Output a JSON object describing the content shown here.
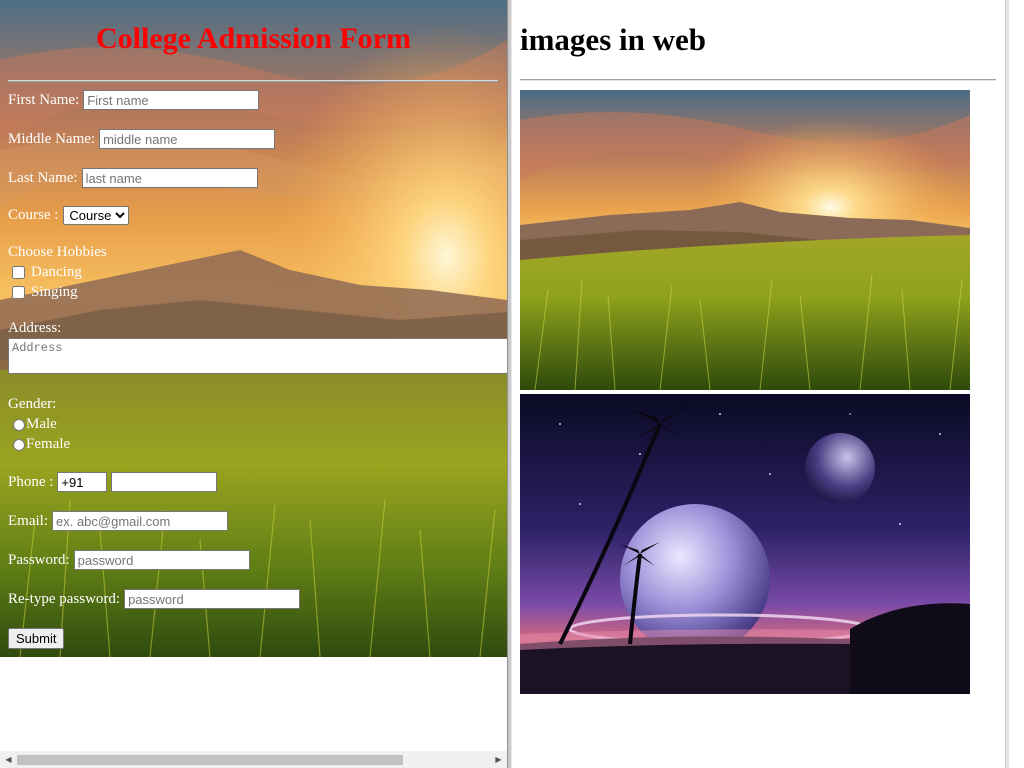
{
  "form": {
    "title": "College Admission Form",
    "first_name": {
      "label": "First Name:",
      "placeholder": "First name"
    },
    "middle_name": {
      "label": "Middle Name:",
      "placeholder": "middle name"
    },
    "last_name": {
      "label": "Last Name:",
      "placeholder": "last name"
    },
    "course": {
      "label": "Course :",
      "selected": "Course"
    },
    "hobbies": {
      "label": "Choose Hobbies",
      "items": [
        "Dancing",
        "Singing"
      ]
    },
    "address": {
      "label": "Address:",
      "placeholder": "Address"
    },
    "gender": {
      "label": "Gender:",
      "options": [
        "Male",
        "Female"
      ]
    },
    "phone": {
      "label": "Phone :",
      "code": "+91",
      "number": ""
    },
    "email": {
      "label": "Email:",
      "placeholder": "ex. abc@gmail.com"
    },
    "password": {
      "label": "Password:",
      "placeholder": "password"
    },
    "retype": {
      "label": "Re-type password:",
      "placeholder": "password"
    },
    "submit_label": "Submit"
  },
  "gallery": {
    "title": "images in web",
    "images": [
      "mountain-sunset-image",
      "space-palm-planet-image"
    ]
  },
  "colors": {
    "title": "#ff0000",
    "form_text": "#ffffff"
  }
}
